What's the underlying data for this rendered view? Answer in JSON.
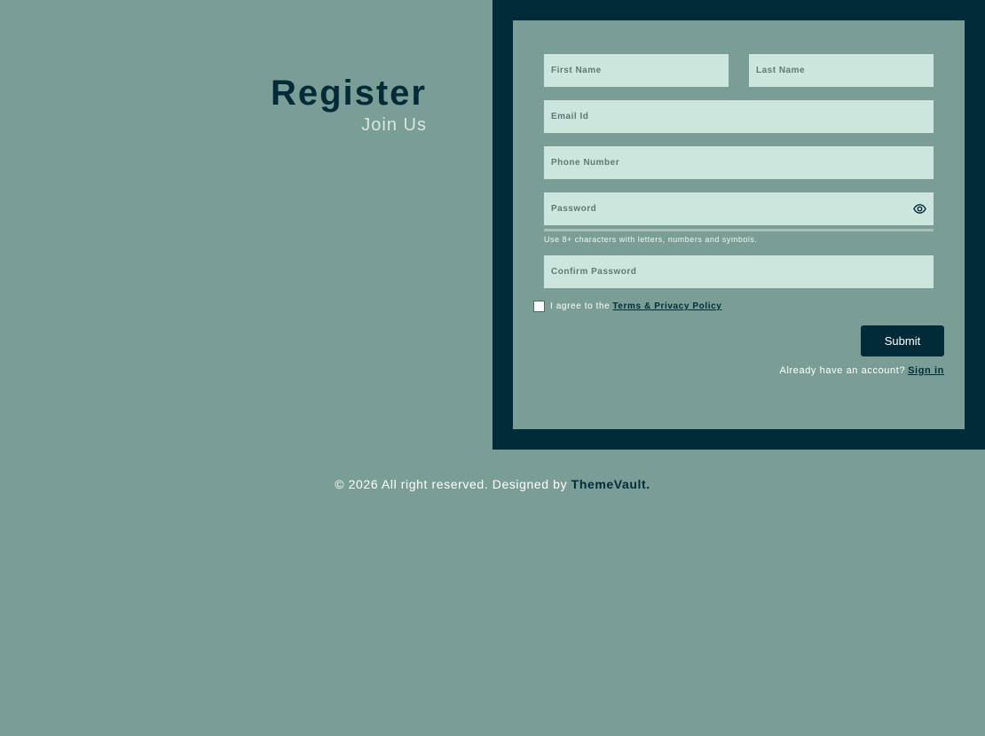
{
  "heading": {
    "title": "Register",
    "subtitle": "Join Us"
  },
  "form": {
    "first_name_placeholder": "First Name",
    "last_name_placeholder": "Last Name",
    "email_placeholder": "Email Id",
    "phone_placeholder": "Phone Number",
    "password_placeholder": "Password",
    "password_hint": "Use 8+ characters with letters, numbers and symbols.",
    "confirm_password_placeholder": "Confirm Password",
    "agree_text": "I agree to the",
    "agree_link": "Terms & Privacy Policy",
    "submit_label": "Submit",
    "signin_text": "Already have an account?",
    "signin_link": "Sign in",
    "agree_checked": false
  },
  "footer": {
    "text": "© 2026 All right reserved. Designed by",
    "brand": "ThemeVault."
  },
  "colors": {
    "background": "#7a9e95",
    "dark": "#022b3a",
    "field": "#cce5dd"
  },
  "icons": {
    "password_toggle": "eye-icon"
  }
}
